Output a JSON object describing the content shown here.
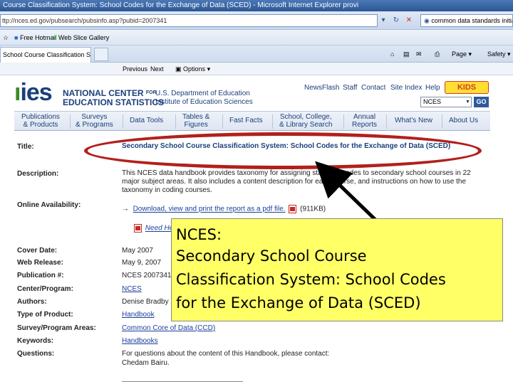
{
  "browser": {
    "window_title": "Course Classification System: School Codes for the Exchange of Data (SCED) - Microsoft Internet Explorer provi",
    "address": "ttp://nces.ed.gov/pubsearch/pubsinfo.asp?pubid=2007341",
    "search_text": "common data standards initiat",
    "favorites": [
      "Free Hotmail",
      "Web Slice Gallery"
    ],
    "tab_label": "School Course Classification System: S...",
    "commands": [
      "Page",
      "Safety"
    ],
    "find_bar": [
      "Previous",
      "Next",
      "Options"
    ]
  },
  "header": {
    "logo_mark": "ies",
    "org_line1": "NATIONAL CENTER",
    "org_for": "FOR",
    "org_line2": "EDUCATION STATISTICS",
    "dept_line1": "U.S. Department of Education",
    "dept_line2": "Institute of Education Sciences",
    "top_links": [
      "NewsFlash",
      "Staff",
      "Contact",
      "Site Index",
      "Help"
    ],
    "kids_label": "KIDS",
    "search_value": "NCES",
    "go_label": "GO",
    "nav": [
      {
        "l1": "Publications",
        "l2": "& Products"
      },
      {
        "l1": "Surveys",
        "l2": "& Programs"
      },
      {
        "l1": "Data Tools",
        "l2": ""
      },
      {
        "l1": "Tables &",
        "l2": "Figures"
      },
      {
        "l1": "Fast Facts",
        "l2": ""
      },
      {
        "l1": "School, College,",
        "l2": "& Library Search"
      },
      {
        "l1": "Annual",
        "l2": "Reports"
      },
      {
        "l1": "What's New",
        "l2": ""
      },
      {
        "l1": "About Us",
        "l2": ""
      }
    ]
  },
  "record": {
    "title_label": "Title:",
    "title_value": "Secondary School Course Classification System: School Codes for the Exchange of Data (SCED)",
    "description_label": "Description:",
    "description_value": "This NCES data handbook provides taxonomy for assigning standard codes to secondary school courses in 22 major subject areas. It also includes a content description for each course, and instructions on how to use the taxonomy in coding courses.",
    "online_label": "Online Availability:",
    "online_arrow": "→",
    "online_link": "Download, view and print the report as a pdf file.",
    "online_size": "(911KB)",
    "need_help": "Need He",
    "cover_date_label": "Cover Date:",
    "cover_date": "May 2007",
    "web_release_label": "Web Release:",
    "web_release": "May 9, 2007",
    "pub_num_label": "Publication #:",
    "pub_num": "NCES 2007341",
    "center_label": "Center/Program:",
    "center": "NCES",
    "authors_label": "Authors:",
    "authors": "Denise Bradby",
    "type_label": "Type of Product:",
    "type": "Handbook",
    "survey_label": "Survey/Program Areas:",
    "survey": "Common Core of Data (CCD)",
    "keywords_label": "Keywords:",
    "keywords": "Handbooks",
    "questions_label": "Questions:",
    "questions": "For questions about the content of this Handbook, please contact:",
    "questions_contact": "Chedam Bairu."
  },
  "callout": {
    "heading": "NCES:",
    "body_lines": [
      "Secondary School Course",
      "Classification System:  School Codes",
      "for the Exchange of Data (SCED)"
    ]
  },
  "colors": {
    "annotation_oval": "#b1201c",
    "callout_fill": "#ffff66",
    "nces_blue": "#1a3f7a"
  }
}
